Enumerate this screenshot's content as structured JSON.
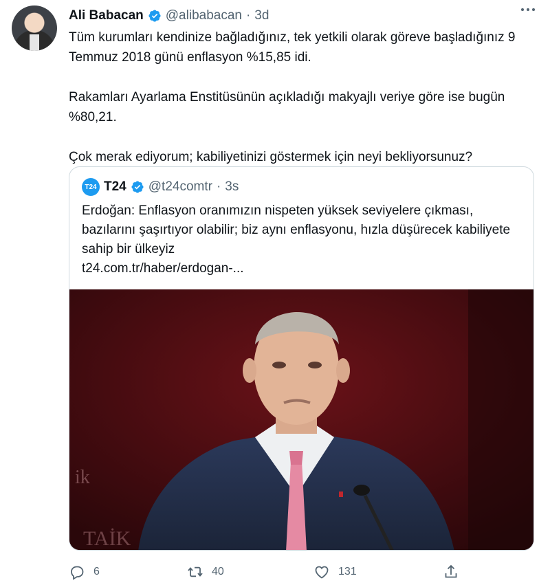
{
  "tweet": {
    "author_name": "Ali Babacan",
    "handle": "@alibabacan",
    "separator": "·",
    "time": "3d",
    "paragraphs": [
      "Tüm kurumları kendinize bağladığınız, tek yetkili olarak göreve başladığınız 9 Temmuz 2018 günü enflasyon %15,85 idi.",
      "Rakamları Ayarlama Enstitüsünün açıkladığı makyajlı veriye göre ise bugün %80,21.",
      "Çok merak ediyorum; kabiliyetinizi göstermek için neyi bekliyorsunuz?"
    ]
  },
  "quoted": {
    "logo_text": "T24",
    "author_name": "T24",
    "handle": "@t24comtr",
    "separator": "·",
    "time": "3s",
    "text": "Erdoğan: Enflasyon oranımızın nispeten yüksek seviyelere çıkması, bazılarını şaşırtıyor olabilir; biz aynı enflasyonu, hızla düşürecek kabiliyete sahip bir ülkeyiz",
    "link": "t24.com.tr/haber/erdogan-...",
    "image_backdrop_text_1": "ik",
    "image_backdrop_text_2": "TAİK"
  },
  "actions": {
    "replies": "6",
    "retweets": "40",
    "likes": "131",
    "reply_icon": "reply-icon",
    "retweet_icon": "retweet-icon",
    "like_icon": "heart-icon",
    "share_icon": "share-icon"
  },
  "colors": {
    "verified": "#1d9bf0",
    "secondary_text": "#536471",
    "border": "#cfd9de"
  }
}
